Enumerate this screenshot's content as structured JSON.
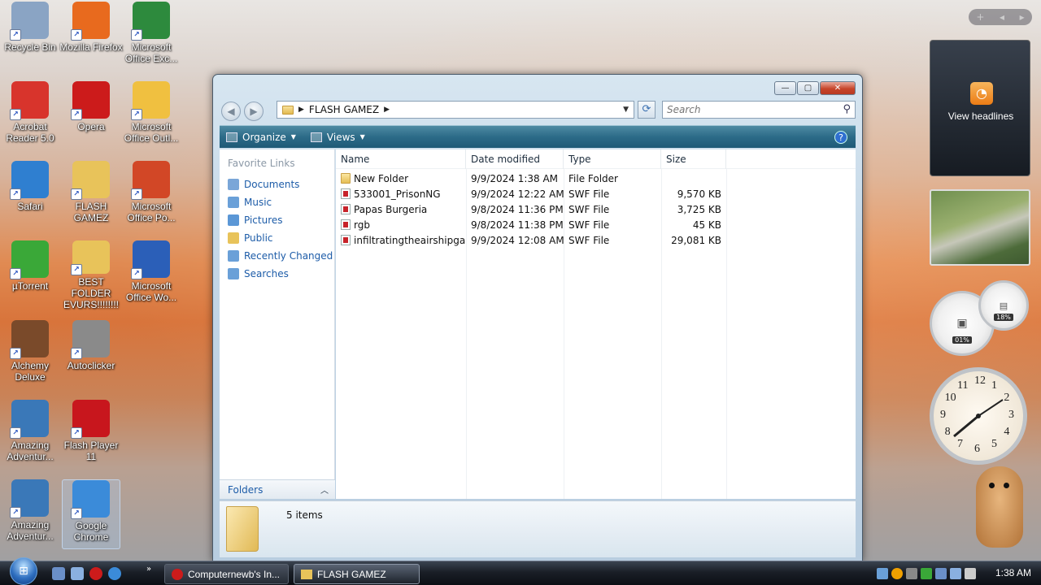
{
  "desktop": {
    "icons": [
      {
        "label": "Recycle Bin",
        "icon": "recycle-bin-icon",
        "color": "#8aa4c4"
      },
      {
        "label": "Mozilla Firefox",
        "icon": "firefox-icon",
        "color": "#e86a1e"
      },
      {
        "label": "Microsoft Office Exc...",
        "icon": "excel-icon",
        "color": "#2d8a3d"
      },
      {
        "label": "Acrobat Reader 5.0",
        "icon": "acrobat-icon",
        "color": "#d8342c"
      },
      {
        "label": "Opera",
        "icon": "opera-icon",
        "color": "#cc1b1b"
      },
      {
        "label": "Microsoft Office Outl...",
        "icon": "outlook-icon",
        "color": "#f0c040"
      },
      {
        "label": "Safari",
        "icon": "safari-icon",
        "color": "#2f7fd0"
      },
      {
        "label": "FLASH GAMEZ",
        "icon": "folder-icon",
        "color": "#e8c35a"
      },
      {
        "label": "Microsoft Office Po...",
        "icon": "powerpoint-icon",
        "color": "#d24726"
      },
      {
        "label": "µTorrent",
        "icon": "utorrent-icon",
        "color": "#3aa838"
      },
      {
        "label": "BEST FOLDER EVURS!!!!!!!!",
        "icon": "folder-icon",
        "color": "#e8c35a"
      },
      {
        "label": "Microsoft Office Wo...",
        "icon": "word-icon",
        "color": "#2b5fb8"
      },
      {
        "label": "Alchemy Deluxe",
        "icon": "alchemy-icon",
        "color": "#7a4a2a"
      },
      {
        "label": "Autoclicker",
        "icon": "mouse-icon",
        "color": "#8a8a8a"
      },
      {
        "label": "Amazing Adventur...",
        "icon": "amazing-adventures-icon",
        "color": "#3a78b8"
      },
      {
        "label": "Flash Player 11",
        "icon": "flash-player-icon",
        "color": "#c8161d"
      },
      {
        "label": "Amazing Adventur...",
        "icon": "amazing-adventures-icon",
        "color": "#3a78b8"
      },
      {
        "label": "Google Chrome",
        "icon": "chrome-icon",
        "color": "#3b8bd9"
      }
    ]
  },
  "window": {
    "breadcrumb": "FLASH GAMEZ",
    "search_placeholder": "Search",
    "toolbar": {
      "organize": "Organize",
      "views": "Views"
    },
    "favorite_links_title": "Favorite Links",
    "favorite_links": [
      {
        "label": "Documents",
        "color": "#7aa6d8"
      },
      {
        "label": "Music",
        "color": "#6aa0d8"
      },
      {
        "label": "Pictures",
        "color": "#5b97d6"
      },
      {
        "label": "Public",
        "color": "#e8c35a"
      },
      {
        "label": "Recently Changed",
        "color": "#6aa0d8"
      },
      {
        "label": "Searches",
        "color": "#6aa0d8"
      }
    ],
    "folders_label": "Folders",
    "columns": [
      "Name",
      "Date modified",
      "Type",
      "Size"
    ],
    "files": [
      {
        "name": "New Folder",
        "date": "9/9/2024 1:38 AM",
        "type": "File Folder",
        "size": "",
        "kind": "folder"
      },
      {
        "name": "533001_PrisonNG",
        "date": "9/9/2024 12:22 AM",
        "type": "SWF File",
        "size": "9,570 KB",
        "kind": "swf"
      },
      {
        "name": "Papas Burgeria",
        "date": "9/8/2024 11:36 PM",
        "type": "SWF File",
        "size": "3,725 KB",
        "kind": "swf"
      },
      {
        "name": "rgb",
        "date": "9/8/2024 11:38 PM",
        "type": "SWF File",
        "size": "45 KB",
        "kind": "swf"
      },
      {
        "name": "infiltratingtheairshipga...",
        "date": "9/9/2024 12:08 AM",
        "type": "SWF File",
        "size": "29,081 KB",
        "kind": "swf"
      }
    ],
    "status_items": "5 items"
  },
  "sidebar": {
    "rss_label": "View headlines",
    "cpu_value": "01%",
    "mem_value": "18%",
    "clock_numbers": [
      "12",
      "1",
      "2",
      "3",
      "4",
      "5",
      "6",
      "7",
      "8",
      "9",
      "10",
      "11"
    ]
  },
  "taskbar": {
    "start_glyph": "⊞",
    "buttons": [
      {
        "label": "Computernewb's In..."
      },
      {
        "label": "FLASH GAMEZ"
      }
    ],
    "time": "1:38 AM",
    "accent": "#2f6fc0"
  }
}
